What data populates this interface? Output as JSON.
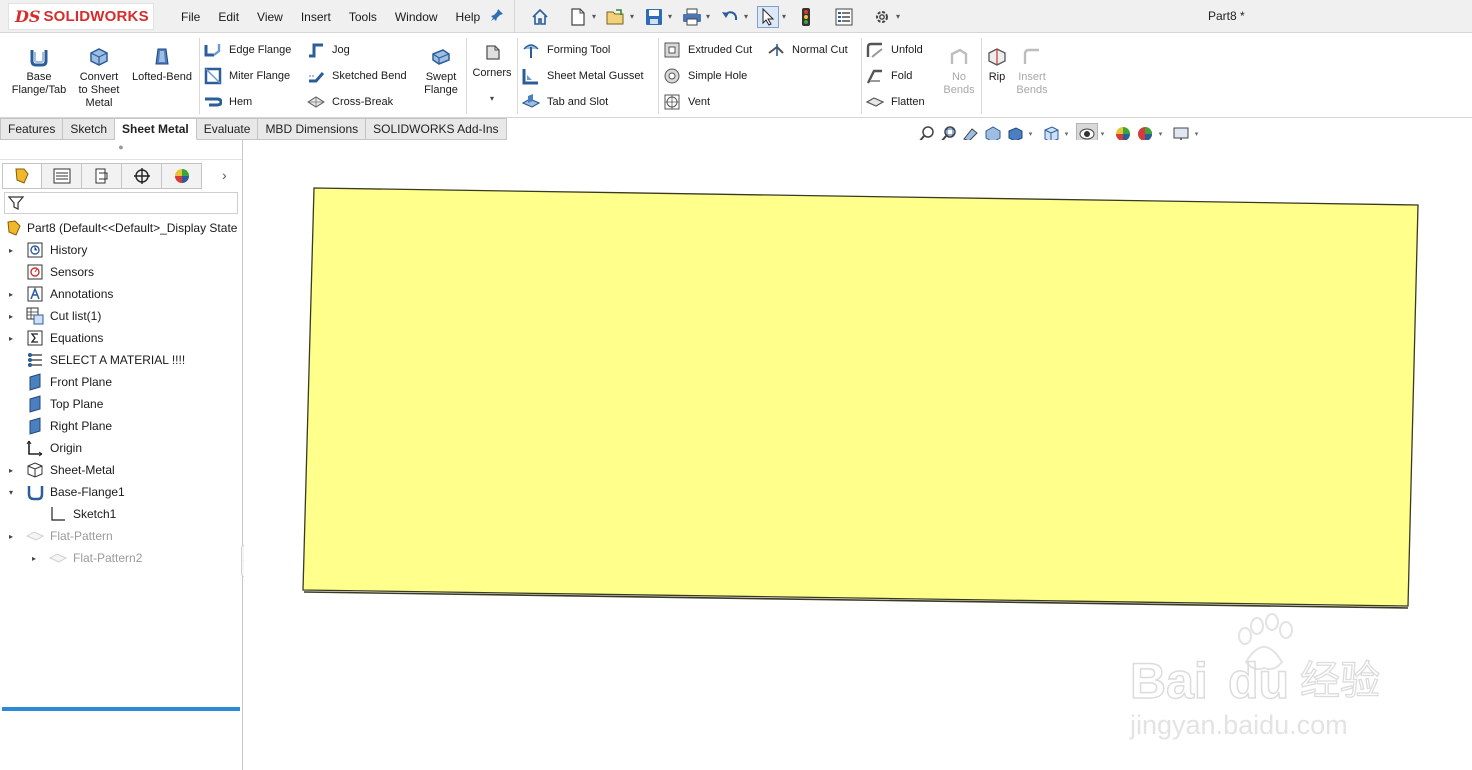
{
  "app": {
    "logo_prefix": "DS",
    "logo_text": "SOLIDWORKS",
    "document_title": "Part8 *"
  },
  "menu": [
    "File",
    "Edit",
    "View",
    "Insert",
    "Tools",
    "Window",
    "Help"
  ],
  "quick_access": [
    {
      "icon": "home-icon",
      "dropdown": false
    },
    {
      "icon": "new-document-icon",
      "dropdown": true
    },
    {
      "icon": "open-folder-icon",
      "dropdown": true
    },
    {
      "icon": "save-icon",
      "dropdown": true
    },
    {
      "icon": "print-icon",
      "dropdown": true
    },
    {
      "icon": "undo-icon",
      "dropdown": true
    },
    {
      "icon": "select-arrow-icon",
      "dropdown": true
    },
    {
      "icon": "rebuild-traffic-light-icon",
      "dropdown": false
    },
    {
      "icon": "file-properties-icon",
      "dropdown": false
    },
    {
      "icon": "options-gear-icon",
      "dropdown": true
    }
  ],
  "ribbon": {
    "base_flange": "Base\nFlange/Tab",
    "convert": "Convert\nto Sheet\nMetal",
    "lofted_bend": "Lofted-Bend",
    "edge_flange": "Edge Flange",
    "miter_flange": "Miter Flange",
    "hem": "Hem",
    "jog": "Jog",
    "sketched_bend": "Sketched Bend",
    "cross_break": "Cross-Break",
    "swept_flange": "Swept\nFlange",
    "corners": "Corners",
    "forming_tool": "Forming Tool",
    "sheet_metal_gusset": "Sheet Metal Gusset",
    "tab_and_slot": "Tab and Slot",
    "extruded_cut": "Extruded Cut",
    "simple_hole": "Simple Hole",
    "vent": "Vent",
    "normal_cut": "Normal Cut",
    "unfold": "Unfold",
    "fold": "Fold",
    "flatten": "Flatten",
    "no_bends": "No\nBends",
    "rip": "Rip",
    "insert_bends": "Insert\nBends"
  },
  "tabs": [
    {
      "label": "Features",
      "active": false
    },
    {
      "label": "Sketch",
      "active": false
    },
    {
      "label": "Sheet Metal",
      "active": true
    },
    {
      "label": "Evaluate",
      "active": false
    },
    {
      "label": "MBD Dimensions",
      "active": false
    },
    {
      "label": "SOLIDWORKS Add-Ins",
      "active": false
    }
  ],
  "feature_tree": {
    "root": "Part8  (Default<<Default>_Display State",
    "items": [
      {
        "label": "History",
        "icon": "history-icon",
        "expandable": true
      },
      {
        "label": "Sensors",
        "icon": "sensors-icon",
        "expandable": false
      },
      {
        "label": "Annotations",
        "icon": "annotations-icon",
        "expandable": true
      },
      {
        "label": "Cut list(1)",
        "icon": "cut-list-icon",
        "expandable": true
      },
      {
        "label": "Equations",
        "icon": "equations-icon",
        "expandable": true
      },
      {
        "label": "SELECT A MATERIAL !!!!",
        "icon": "material-icon",
        "expandable": false
      },
      {
        "label": "Front Plane",
        "icon": "plane-icon",
        "expandable": false
      },
      {
        "label": "Top Plane",
        "icon": "plane-icon",
        "expandable": false
      },
      {
        "label": "Right Plane",
        "icon": "plane-icon",
        "expandable": false
      },
      {
        "label": "Origin",
        "icon": "origin-icon",
        "expandable": false
      },
      {
        "label": "Sheet-Metal",
        "icon": "sheet-metal-icon",
        "expandable": true
      },
      {
        "label": "Base-Flange1",
        "icon": "base-flange-icon",
        "expandable": true,
        "expanded": true
      },
      {
        "label": "Sketch1",
        "icon": "sketch-icon",
        "child": true
      },
      {
        "label": "Flat-Pattern",
        "icon": "flat-pattern-icon",
        "expandable": true,
        "dim": true
      },
      {
        "label": "Flat-Pattern2",
        "icon": "flat-pattern-icon",
        "expandable": true,
        "dim": true,
        "child": true
      }
    ]
  },
  "model": {
    "fill_color": "#ffff8c",
    "edge_color": "#3a3a22"
  },
  "watermark": {
    "brand": "Bai",
    "brand_suffix": "du",
    "chinese": "经验",
    "url": "jingyan.baidu.com"
  }
}
